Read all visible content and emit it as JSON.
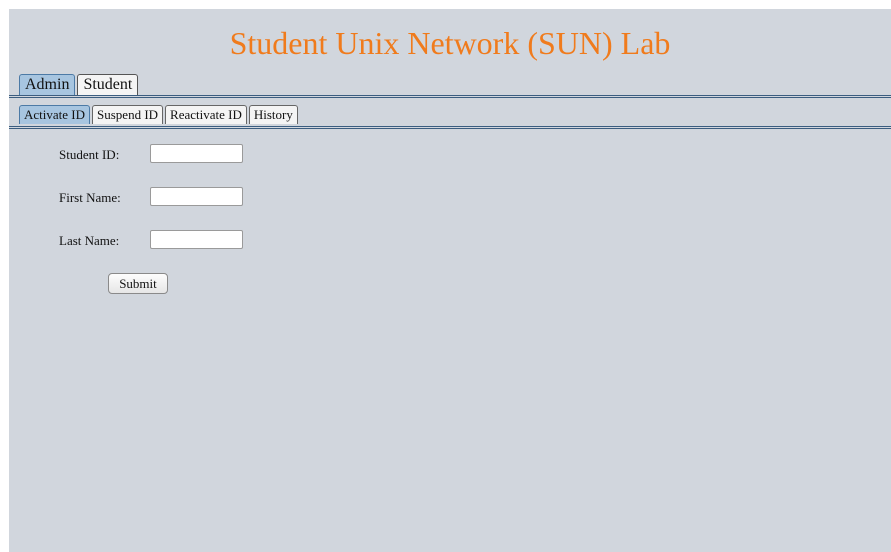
{
  "app": {
    "title": "Student Unix Network (SUN) Lab"
  },
  "main_tabs": [
    {
      "label": "Admin",
      "active": true
    },
    {
      "label": "Student",
      "active": false
    }
  ],
  "sub_tabs": [
    {
      "label": "Activate ID",
      "active": true
    },
    {
      "label": "Suspend ID",
      "active": false
    },
    {
      "label": "Reactivate ID",
      "active": false
    },
    {
      "label": "History",
      "active": false
    }
  ],
  "form": {
    "student_id": {
      "label": "Student ID:",
      "value": "",
      "placeholder": ""
    },
    "first_name": {
      "label": "First Name:",
      "value": "",
      "placeholder": ""
    },
    "last_name": {
      "label": "Last Name:",
      "value": "",
      "placeholder": ""
    },
    "submit_label": "Submit"
  },
  "colors": {
    "title": "#f07b1c",
    "background": "#d1d6dd",
    "active_tab": "#a7c5e0",
    "rule": "#3b5d80"
  }
}
